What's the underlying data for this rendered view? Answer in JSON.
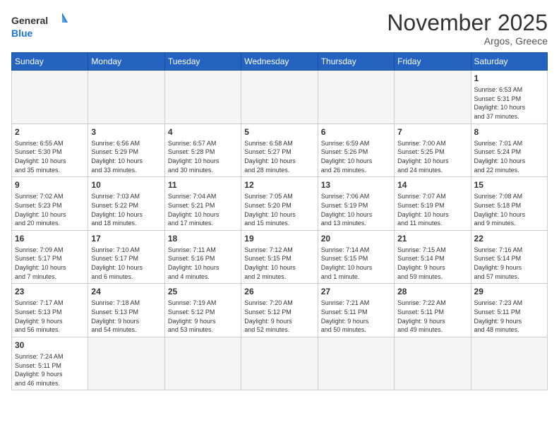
{
  "header": {
    "logo_general": "General",
    "logo_blue": "Blue",
    "month_year": "November 2025",
    "location": "Argos, Greece"
  },
  "weekdays": [
    "Sunday",
    "Monday",
    "Tuesday",
    "Wednesday",
    "Thursday",
    "Friday",
    "Saturday"
  ],
  "weeks": [
    [
      {
        "day": "",
        "info": ""
      },
      {
        "day": "",
        "info": ""
      },
      {
        "day": "",
        "info": ""
      },
      {
        "day": "",
        "info": ""
      },
      {
        "day": "",
        "info": ""
      },
      {
        "day": "",
        "info": ""
      },
      {
        "day": "1",
        "info": "Sunrise: 6:53 AM\nSunset: 5:31 PM\nDaylight: 10 hours\nand 37 minutes."
      }
    ],
    [
      {
        "day": "2",
        "info": "Sunrise: 6:55 AM\nSunset: 5:30 PM\nDaylight: 10 hours\nand 35 minutes."
      },
      {
        "day": "3",
        "info": "Sunrise: 6:56 AM\nSunset: 5:29 PM\nDaylight: 10 hours\nand 33 minutes."
      },
      {
        "day": "4",
        "info": "Sunrise: 6:57 AM\nSunset: 5:28 PM\nDaylight: 10 hours\nand 30 minutes."
      },
      {
        "day": "5",
        "info": "Sunrise: 6:58 AM\nSunset: 5:27 PM\nDaylight: 10 hours\nand 28 minutes."
      },
      {
        "day": "6",
        "info": "Sunrise: 6:59 AM\nSunset: 5:26 PM\nDaylight: 10 hours\nand 26 minutes."
      },
      {
        "day": "7",
        "info": "Sunrise: 7:00 AM\nSunset: 5:25 PM\nDaylight: 10 hours\nand 24 minutes."
      },
      {
        "day": "8",
        "info": "Sunrise: 7:01 AM\nSunset: 5:24 PM\nDaylight: 10 hours\nand 22 minutes."
      }
    ],
    [
      {
        "day": "9",
        "info": "Sunrise: 7:02 AM\nSunset: 5:23 PM\nDaylight: 10 hours\nand 20 minutes."
      },
      {
        "day": "10",
        "info": "Sunrise: 7:03 AM\nSunset: 5:22 PM\nDaylight: 10 hours\nand 18 minutes."
      },
      {
        "day": "11",
        "info": "Sunrise: 7:04 AM\nSunset: 5:21 PM\nDaylight: 10 hours\nand 17 minutes."
      },
      {
        "day": "12",
        "info": "Sunrise: 7:05 AM\nSunset: 5:20 PM\nDaylight: 10 hours\nand 15 minutes."
      },
      {
        "day": "13",
        "info": "Sunrise: 7:06 AM\nSunset: 5:19 PM\nDaylight: 10 hours\nand 13 minutes."
      },
      {
        "day": "14",
        "info": "Sunrise: 7:07 AM\nSunset: 5:19 PM\nDaylight: 10 hours\nand 11 minutes."
      },
      {
        "day": "15",
        "info": "Sunrise: 7:08 AM\nSunset: 5:18 PM\nDaylight: 10 hours\nand 9 minutes."
      }
    ],
    [
      {
        "day": "16",
        "info": "Sunrise: 7:09 AM\nSunset: 5:17 PM\nDaylight: 10 hours\nand 7 minutes."
      },
      {
        "day": "17",
        "info": "Sunrise: 7:10 AM\nSunset: 5:17 PM\nDaylight: 10 hours\nand 6 minutes."
      },
      {
        "day": "18",
        "info": "Sunrise: 7:11 AM\nSunset: 5:16 PM\nDaylight: 10 hours\nand 4 minutes."
      },
      {
        "day": "19",
        "info": "Sunrise: 7:12 AM\nSunset: 5:15 PM\nDaylight: 10 hours\nand 2 minutes."
      },
      {
        "day": "20",
        "info": "Sunrise: 7:14 AM\nSunset: 5:15 PM\nDaylight: 10 hours\nand 1 minute."
      },
      {
        "day": "21",
        "info": "Sunrise: 7:15 AM\nSunset: 5:14 PM\nDaylight: 9 hours\nand 59 minutes."
      },
      {
        "day": "22",
        "info": "Sunrise: 7:16 AM\nSunset: 5:14 PM\nDaylight: 9 hours\nand 57 minutes."
      }
    ],
    [
      {
        "day": "23",
        "info": "Sunrise: 7:17 AM\nSunset: 5:13 PM\nDaylight: 9 hours\nand 56 minutes."
      },
      {
        "day": "24",
        "info": "Sunrise: 7:18 AM\nSunset: 5:13 PM\nDaylight: 9 hours\nand 54 minutes."
      },
      {
        "day": "25",
        "info": "Sunrise: 7:19 AM\nSunset: 5:12 PM\nDaylight: 9 hours\nand 53 minutes."
      },
      {
        "day": "26",
        "info": "Sunrise: 7:20 AM\nSunset: 5:12 PM\nDaylight: 9 hours\nand 52 minutes."
      },
      {
        "day": "27",
        "info": "Sunrise: 7:21 AM\nSunset: 5:11 PM\nDaylight: 9 hours\nand 50 minutes."
      },
      {
        "day": "28",
        "info": "Sunrise: 7:22 AM\nSunset: 5:11 PM\nDaylight: 9 hours\nand 49 minutes."
      },
      {
        "day": "29",
        "info": "Sunrise: 7:23 AM\nSunset: 5:11 PM\nDaylight: 9 hours\nand 48 minutes."
      }
    ],
    [
      {
        "day": "30",
        "info": "Sunrise: 7:24 AM\nSunset: 5:11 PM\nDaylight: 9 hours\nand 46 minutes."
      },
      {
        "day": "",
        "info": ""
      },
      {
        "day": "",
        "info": ""
      },
      {
        "day": "",
        "info": ""
      },
      {
        "day": "",
        "info": ""
      },
      {
        "day": "",
        "info": ""
      },
      {
        "day": "",
        "info": ""
      }
    ]
  ]
}
